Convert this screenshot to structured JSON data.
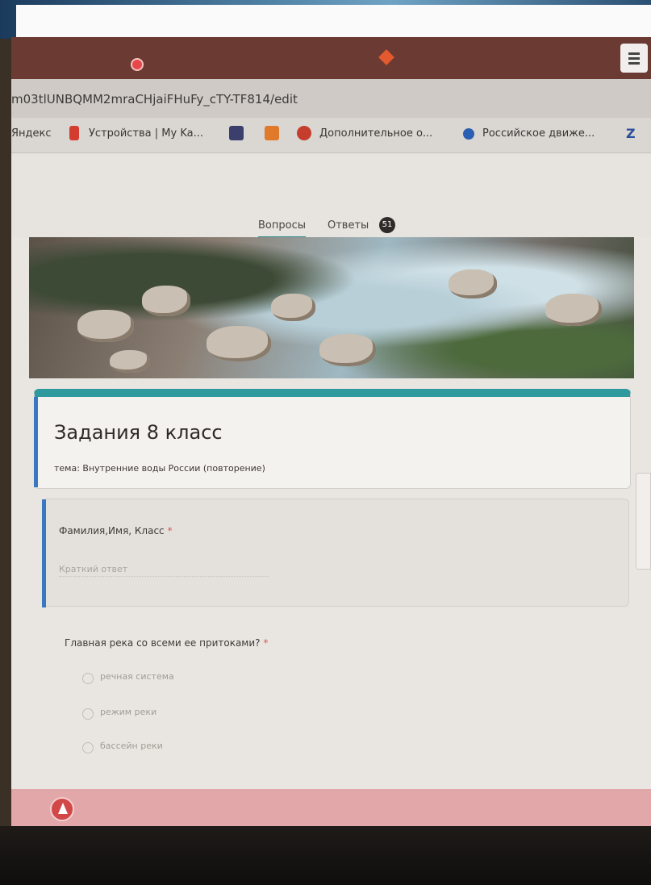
{
  "browser": {
    "url": "m03tlUNBQMM2mraCHjaiFHuFy_cTY-TF814/edit",
    "bookmarks": [
      {
        "label": "Яндекс",
        "icon": "yandex-icon"
      },
      {
        "label": "Устройства | My Ka...",
        "icon": "kaspersky-icon",
        "color": "#d33c2e"
      },
      {
        "label": "",
        "icon": "vk-icon",
        "color": "#3b3f6b"
      },
      {
        "label": "",
        "icon": "odnoklassniki-icon",
        "color": "#e07a2a"
      },
      {
        "label": "Дополнительное о...",
        "icon": "edu-icon",
        "color": "#c53d2c"
      },
      {
        "label": "Российское движе...",
        "icon": "rdsh-icon",
        "color": "#2b5fb4"
      },
      {
        "label": "Z",
        "icon": "z-icon"
      }
    ]
  },
  "form": {
    "tabs": [
      {
        "label": "Вопросы",
        "active": true
      },
      {
        "label": "Ответы",
        "badge": "51"
      }
    ],
    "title": "Задания 8 класс",
    "description": "тема: Внутренние воды России (повторение)",
    "questions": [
      {
        "label": "Фамилия,Имя, Класс",
        "required_mark": "*",
        "placeholder": "Краткий ответ"
      },
      {
        "label": "Главная река со всеми ее притоками?",
        "required_mark": "*",
        "options": [
          "речная система",
          "режим реки",
          "бассейн реки"
        ]
      }
    ]
  },
  "colors": {
    "accent": "#2e9a9e",
    "focus_bar": "#3b78c2",
    "required": "#d9534f"
  }
}
